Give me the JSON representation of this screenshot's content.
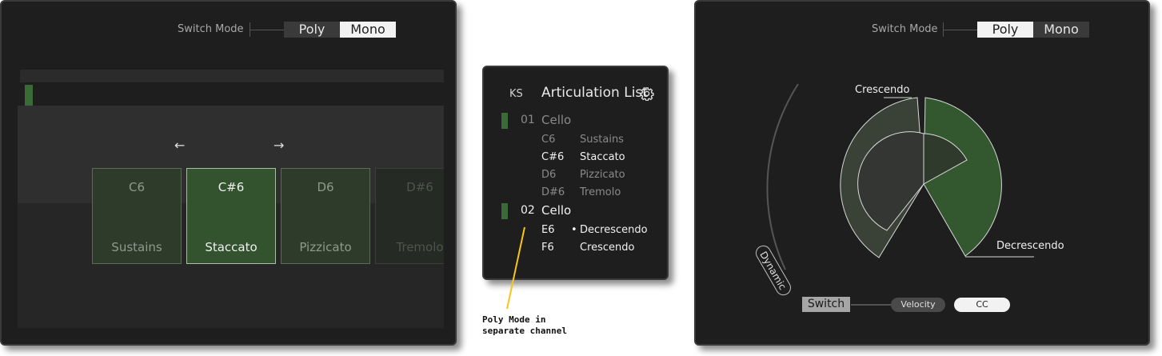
{
  "left_panel": {
    "switch_mode_label": "Switch Mode",
    "mode_poly": "Poly",
    "mode_mono": "Mono",
    "active_mode": "Mono",
    "prev_arrow": "←",
    "next_arrow": "→",
    "cards": [
      {
        "key": "C6",
        "name": "Sustains",
        "state": "normal"
      },
      {
        "key": "C#6",
        "name": "Staccato",
        "state": "active"
      },
      {
        "key": "D6",
        "name": "Pizzicato",
        "state": "normal"
      },
      {
        "key": "D#6",
        "name": "Tremolo",
        "state": "faded"
      }
    ]
  },
  "middle_panel": {
    "ks_label": "KS",
    "title": "Articulation List",
    "gear_icon": "gear-icon",
    "groups": [
      {
        "number": "01",
        "name": "Cello",
        "articulations": [
          {
            "key": "C6",
            "name": "Sustains",
            "selected": false
          },
          {
            "key": "C#6",
            "name": "Staccato",
            "selected": true
          },
          {
            "key": "D6",
            "name": "Pizzicato",
            "selected": false
          },
          {
            "key": "D#6",
            "name": "Tremolo",
            "selected": false
          }
        ]
      },
      {
        "number": "02",
        "name": "Cello",
        "articulations": [
          {
            "key": "E6",
            "name": "Decrescendo",
            "selected": true,
            "bullet": "•"
          },
          {
            "key": "F6",
            "name": "Crescendo",
            "selected": false
          }
        ]
      }
    ]
  },
  "annotation": {
    "line1": "Poly Mode in",
    "line2": "separate channel",
    "color": "#f5c518"
  },
  "right_panel": {
    "switch_mode_label": "Switch Mode",
    "mode_poly": "Poly",
    "mode_mono": "Mono",
    "active_mode": "Poly",
    "dynamic_label": "Dynamic",
    "crescendo_label": "Crescendo",
    "decrescendo_label": "Decrescendo",
    "switch_label": "Switch",
    "velocity_label": "Velocity",
    "cc_label": "CC",
    "active_source": "CC",
    "colors": {
      "green": "#33582f",
      "grey_green": "#3a4238"
    }
  }
}
